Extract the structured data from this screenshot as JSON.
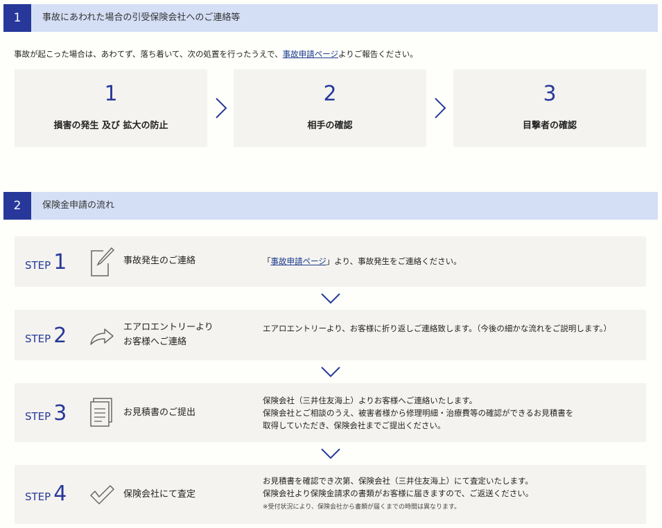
{
  "section1": {
    "number": "1",
    "title": "事故にあわれた場合の引受保険会社へのご連絡等",
    "intro_before": "事故が起こった場合は、あわてず、落ち着いて、次の処置を行ったうえで、",
    "intro_link": "事故申請ページ",
    "intro_after": "よりご報告ください。",
    "boxes": [
      {
        "num": "1",
        "label": "損害の発生 及び 拡大の防止"
      },
      {
        "num": "2",
        "label": "相手の確認"
      },
      {
        "num": "3",
        "label": "目撃者の確認"
      }
    ]
  },
  "section2": {
    "number": "2",
    "title": "保険金申請の流れ",
    "step_word": "STEP",
    "steps": [
      {
        "num": "1",
        "icon": "pen-icon",
        "title": "事故発生のご連絡",
        "desc_before": "「",
        "desc_link": "事故申請ページ",
        "desc_after": "」より、事故発生をご連絡ください。"
      },
      {
        "num": "2",
        "icon": "reply-arrow-icon",
        "title_line1": "エアロエントリーより",
        "title_line2": "お客様へご連絡",
        "desc": "エアロエントリーより、お客様に折り返しご連絡致します。（今後の細かな流れをご説明します。）"
      },
      {
        "num": "3",
        "icon": "document-icon",
        "title": "お見積書のご提出",
        "desc_line1": "保険会社（三井住友海上）よりお客様へご連絡いたします。",
        "desc_line2": "保険会社とご相談のうえ、被害者様から修理明細・治療費等の確認ができるお見積書を",
        "desc_line3": "取得していただき、保険会社までご提出ください。"
      },
      {
        "num": "4",
        "icon": "checkmark-icon",
        "title": "保険会社にて査定",
        "desc_line1": "お見積書を確認でき次第、保険会社（三井住友海上）にて査定いたします。",
        "desc_line2": "保険会社より保険金請求の書類がお客様に届きますので、ご返送ください。",
        "note": "※受付状況により、保険会社から書類が届くまでの時間は異なります。"
      }
    ]
  },
  "colors": {
    "accent": "#27389a",
    "header_bg": "#d4dff6",
    "box_bg": "#f4f3ef",
    "page_bg": "#fefefa"
  }
}
